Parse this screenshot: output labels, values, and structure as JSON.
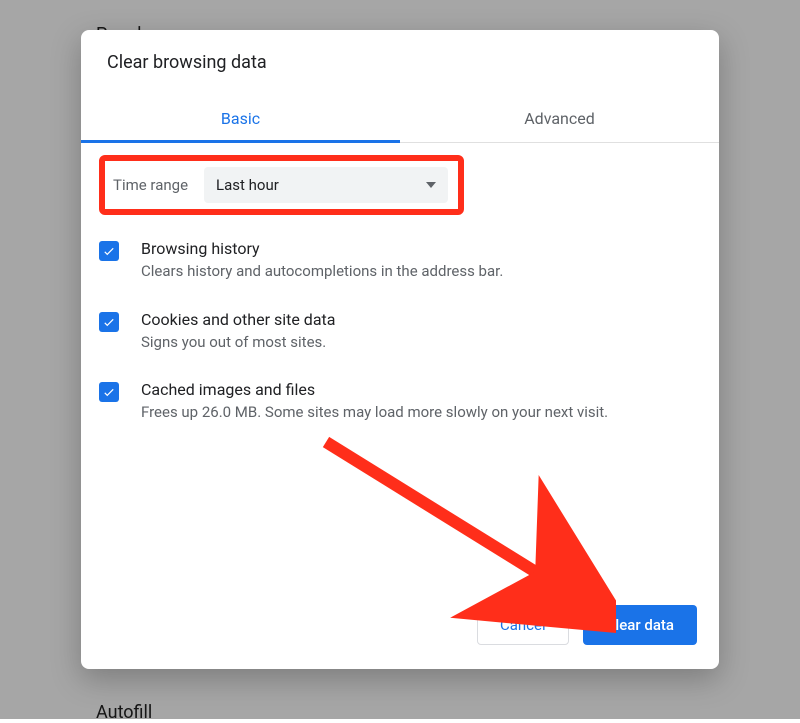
{
  "background": {
    "people_label": "People",
    "autofill_label": "Autofill"
  },
  "dialog": {
    "title": "Clear browsing data",
    "tabs": {
      "basic": "Basic",
      "advanced": "Advanced"
    },
    "time_range": {
      "label": "Time range",
      "selected": "Last hour"
    },
    "options": [
      {
        "title": "Browsing history",
        "subtitle": "Clears history and autocompletions in the address bar."
      },
      {
        "title": "Cookies and other site data",
        "subtitle": "Signs you out of most sites."
      },
      {
        "title": "Cached images and files",
        "subtitle": "Frees up 26.0 MB. Some sites may load more slowly on your next visit."
      }
    ],
    "footer": {
      "cancel": "Cancel",
      "clear": "Clear data"
    }
  },
  "annotation": {
    "arrow_color": "#ff2e1a",
    "highlight_color": "#ff2e1a"
  }
}
